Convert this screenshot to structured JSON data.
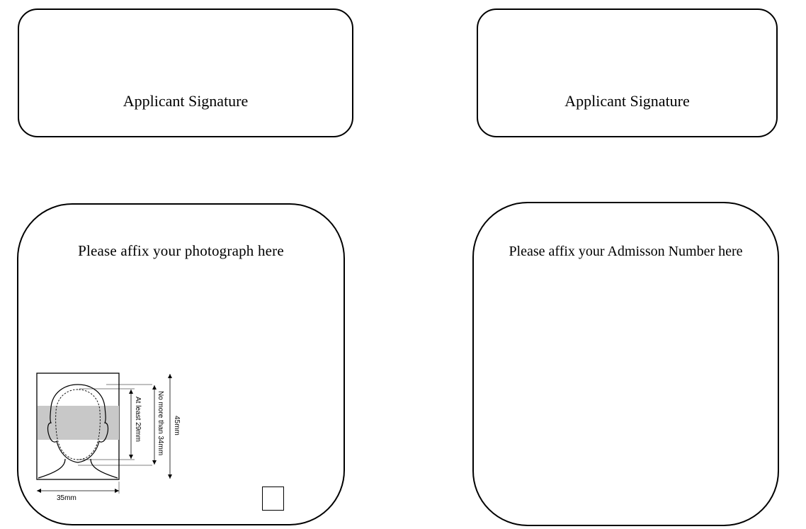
{
  "signature_boxes": [
    {
      "label": "Applicant Signature"
    },
    {
      "label": "Applicant Signature"
    }
  ],
  "photo_box": {
    "title": "Please affix your photograph here",
    "diagram": {
      "width_label": "35mm",
      "height_label": "45mm",
      "max_head_label": "No more than 34mm",
      "min_head_label": "At least 29mm"
    }
  },
  "admission_box": {
    "title": "Please affix your Admisson Number  here"
  }
}
